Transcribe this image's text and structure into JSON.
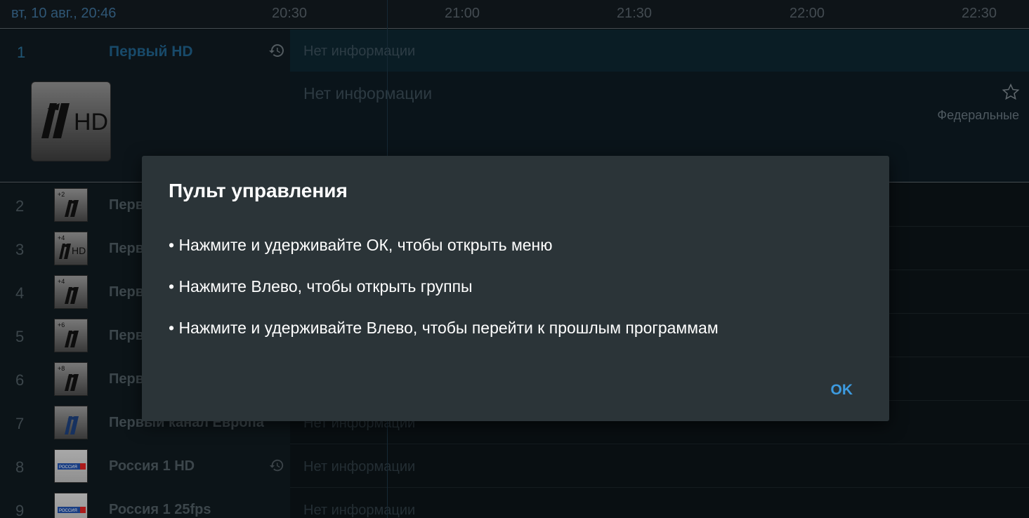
{
  "header": {
    "datetime": "вт, 10 авг., 20:46",
    "timeline": [
      "20:30",
      "21:00",
      "21:30",
      "22:00",
      "22:30"
    ]
  },
  "selected": {
    "number": "1",
    "name": "Первый HD",
    "program": "Нет информации",
    "detail_title": "Нет информации",
    "category": "Федеральные",
    "logo_text": "HD",
    "history_icon": "history-icon",
    "favorite_icon": "star-outline-icon"
  },
  "rows": [
    {
      "number": "2",
      "name": "Перв",
      "badge": "+2",
      "program": "",
      "logo": "perviy"
    },
    {
      "number": "3",
      "name": "Перв",
      "badge": "+4",
      "logo_suffix": "HD",
      "program": "",
      "logo": "perviy"
    },
    {
      "number": "4",
      "name": "Перв",
      "badge": "+4",
      "program": "",
      "logo": "perviy"
    },
    {
      "number": "5",
      "name": "Перв",
      "badge": "+6",
      "program": "",
      "logo": "perviy"
    },
    {
      "number": "6",
      "name": "Перв",
      "badge": "+8",
      "program": "",
      "logo": "perviy"
    },
    {
      "number": "7",
      "name": "Первый канал Европа",
      "badge": "",
      "program": "Нет информации",
      "logo": "perviy"
    },
    {
      "number": "8",
      "name": "Россия 1 HD",
      "badge": "",
      "program": "Нет информации",
      "logo": "rossiya",
      "logo_text": "РОССИЯ",
      "history": true
    },
    {
      "number": "9",
      "name": "Россия 1 25fps",
      "badge": "",
      "program": "Нет информации",
      "logo": "rossiya",
      "logo_text": "РОССИЯ"
    }
  ],
  "dialog": {
    "title": "Пульт управления",
    "tips": [
      "• Нажмите и удерживайте ОК, чтобы открыть меню",
      "• Нажмите Влево, чтобы открыть группы",
      "• Нажмите и удерживайте Влево, чтобы перейти к прошлым программам"
    ],
    "ok_label": "OK"
  },
  "colors": {
    "accent": "#3d9be0",
    "selected_text": "#2a6f96",
    "dialog_bg": "#2b3438"
  }
}
